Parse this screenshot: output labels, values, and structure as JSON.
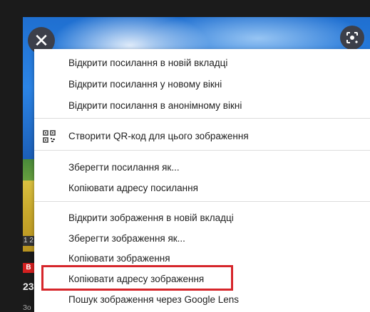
{
  "side": {
    "badge": "1 2",
    "red_badge": "B",
    "number": "23",
    "small": "Зо"
  },
  "buttons": {
    "close_glyph": "✕",
    "close_icon": "close-icon",
    "lens_icon": "google-lens-icon"
  },
  "menu": {
    "group1": [
      "Відкрити посилання в новій вкладці",
      "Відкрити посилання у новому вікні",
      "Відкрити посилання в анонімному вікні"
    ],
    "group2": {
      "icon": "qr-code-icon",
      "label": "Створити QR-код для цього зображення"
    },
    "group3": [
      "Зберегти посилання як...",
      "Копіювати адресу посилання"
    ],
    "group4": [
      "Відкрити зображення в новій вкладці",
      "Зберегти зображення як...",
      "Копіювати зображення",
      "Копіювати адресу зображення",
      "Пошук зображення через Google Lens"
    ],
    "highlighted_item": "Копіювати адресу зображення"
  },
  "colors": {
    "highlight_border": "#d6262b",
    "menu_bg": "#ffffff",
    "text": "#1f1f1f"
  }
}
